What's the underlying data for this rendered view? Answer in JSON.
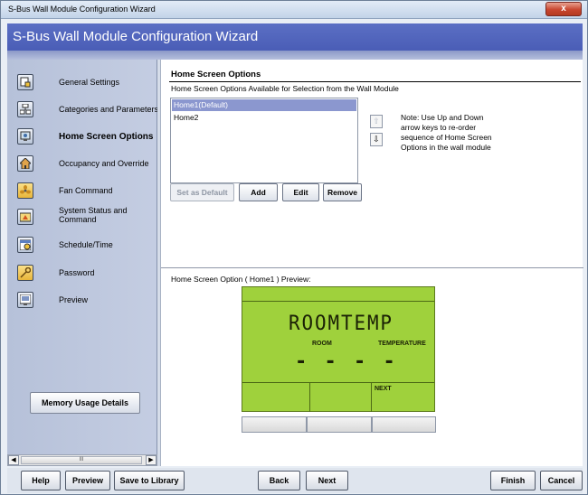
{
  "window": {
    "title": "S-Bus Wall Module Configuration Wizard",
    "close_glyph": "x"
  },
  "header": {
    "title": "S-Bus Wall Module Configuration Wizard"
  },
  "sidebar": {
    "items": [
      {
        "label": "General Settings",
        "icon": "general-settings-icon"
      },
      {
        "label": "Categories and Parameters",
        "icon": "categories-icon"
      },
      {
        "label": "Home Screen Options",
        "icon": "home-screen-icon",
        "active": true
      },
      {
        "label": "Occupancy and Override",
        "icon": "house-icon"
      },
      {
        "label": "Fan Command",
        "icon": "fan-icon"
      },
      {
        "label": "System Status and Command",
        "icon": "system-status-icon"
      },
      {
        "label": "Schedule/Time",
        "icon": "schedule-icon"
      },
      {
        "label": "Password",
        "icon": "key-icon"
      },
      {
        "label": "Preview",
        "icon": "preview-icon"
      }
    ],
    "memory_button": "Memory Usage Details",
    "scroll_thumb": "III"
  },
  "main": {
    "section_title": "Home Screen Options",
    "section_subtitle": "Home Screen Options Available for Selection from the Wall Module",
    "list": [
      {
        "label": "Home1(Default)",
        "selected": true
      },
      {
        "label": "Home2",
        "selected": false
      }
    ],
    "up_arrow": "⇧",
    "down_arrow": "⇩",
    "note": "Note: Use Up and Down arrow keys to re-order sequence of Home Screen Options in the wall module",
    "buttons": {
      "set_default": "Set as Default",
      "add": "Add",
      "edit": "Edit",
      "remove": "Remove"
    },
    "preview_label": "Home Screen Option  ( Home1 ) Preview:",
    "lcd": {
      "big_text": "ROOMTEMP",
      "label_left": "ROOM",
      "label_right": "TEMPERATURE",
      "value": "- - - -",
      "softkey_right": "NEXT"
    },
    "lcd_color": "#9fd13c"
  },
  "footer": {
    "help": "Help",
    "preview": "Preview",
    "save_library": "Save to Library",
    "back": "Back",
    "next": "Next",
    "finish": "Finish",
    "cancel": "Cancel"
  },
  "colors": {
    "header": "#4a5db6",
    "selection": "#8b97cf",
    "close": "#c8462f"
  }
}
